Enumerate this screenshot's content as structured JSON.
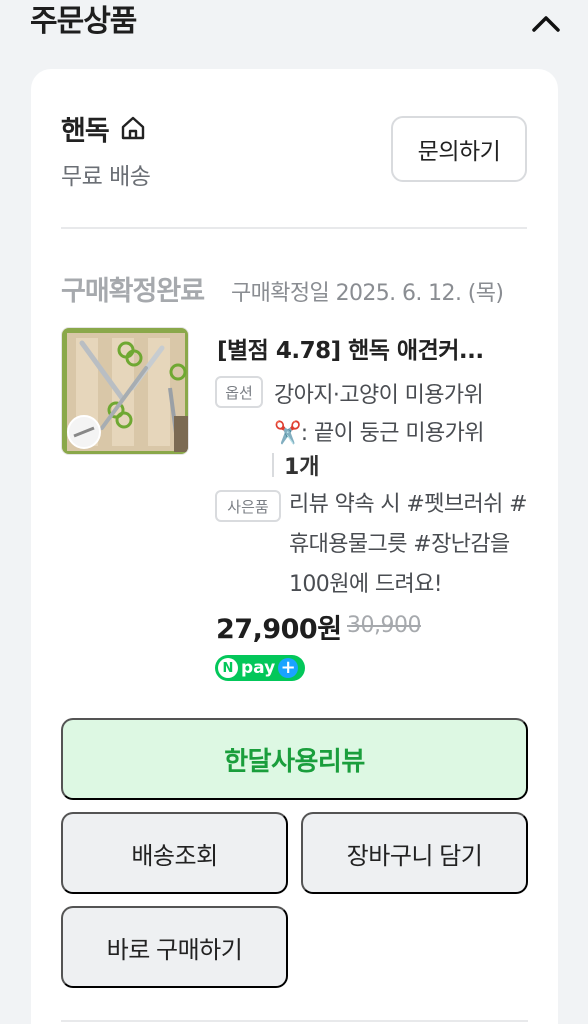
{
  "section": {
    "title": "주문상품"
  },
  "store": {
    "name": "핸독",
    "shipping": "무료 배송",
    "inquiry_label": "문의하기"
  },
  "order": {
    "status": "구매확정완료",
    "confirm_date": "구매확정일 2025. 6. 12. (목)"
  },
  "product": {
    "title": "[별점 4.78] 핸독 애견커...",
    "option_tag": "옵션",
    "option_line1": "강아지·고양이 미용가위",
    "option_line2": "✂️: 끝이 둥근 미용가위",
    "quantity": "1개",
    "gift_tag": "사은품",
    "gift_text": "리뷰 약속 시 #펫브러쉬 #휴대용물그릇 #장난감을 100원에 드려요!",
    "price": "27,900원",
    "original_price": "30,900"
  },
  "npay": {
    "n": "N",
    "label": "pay",
    "plus": "+"
  },
  "actions": {
    "review": "한달사용리뷰",
    "delivery": "배송조회",
    "cart": "장바구니 담기",
    "buy": "바로 구매하기"
  },
  "colors": {
    "accent_green": "#1a9e3c",
    "review_bg": "#ddf8e3",
    "npay_green": "#03c75a",
    "npay_plus": "#1aa3ff"
  },
  "icons": {
    "collapse": "chevron-up-icon",
    "store": "home-icon"
  }
}
